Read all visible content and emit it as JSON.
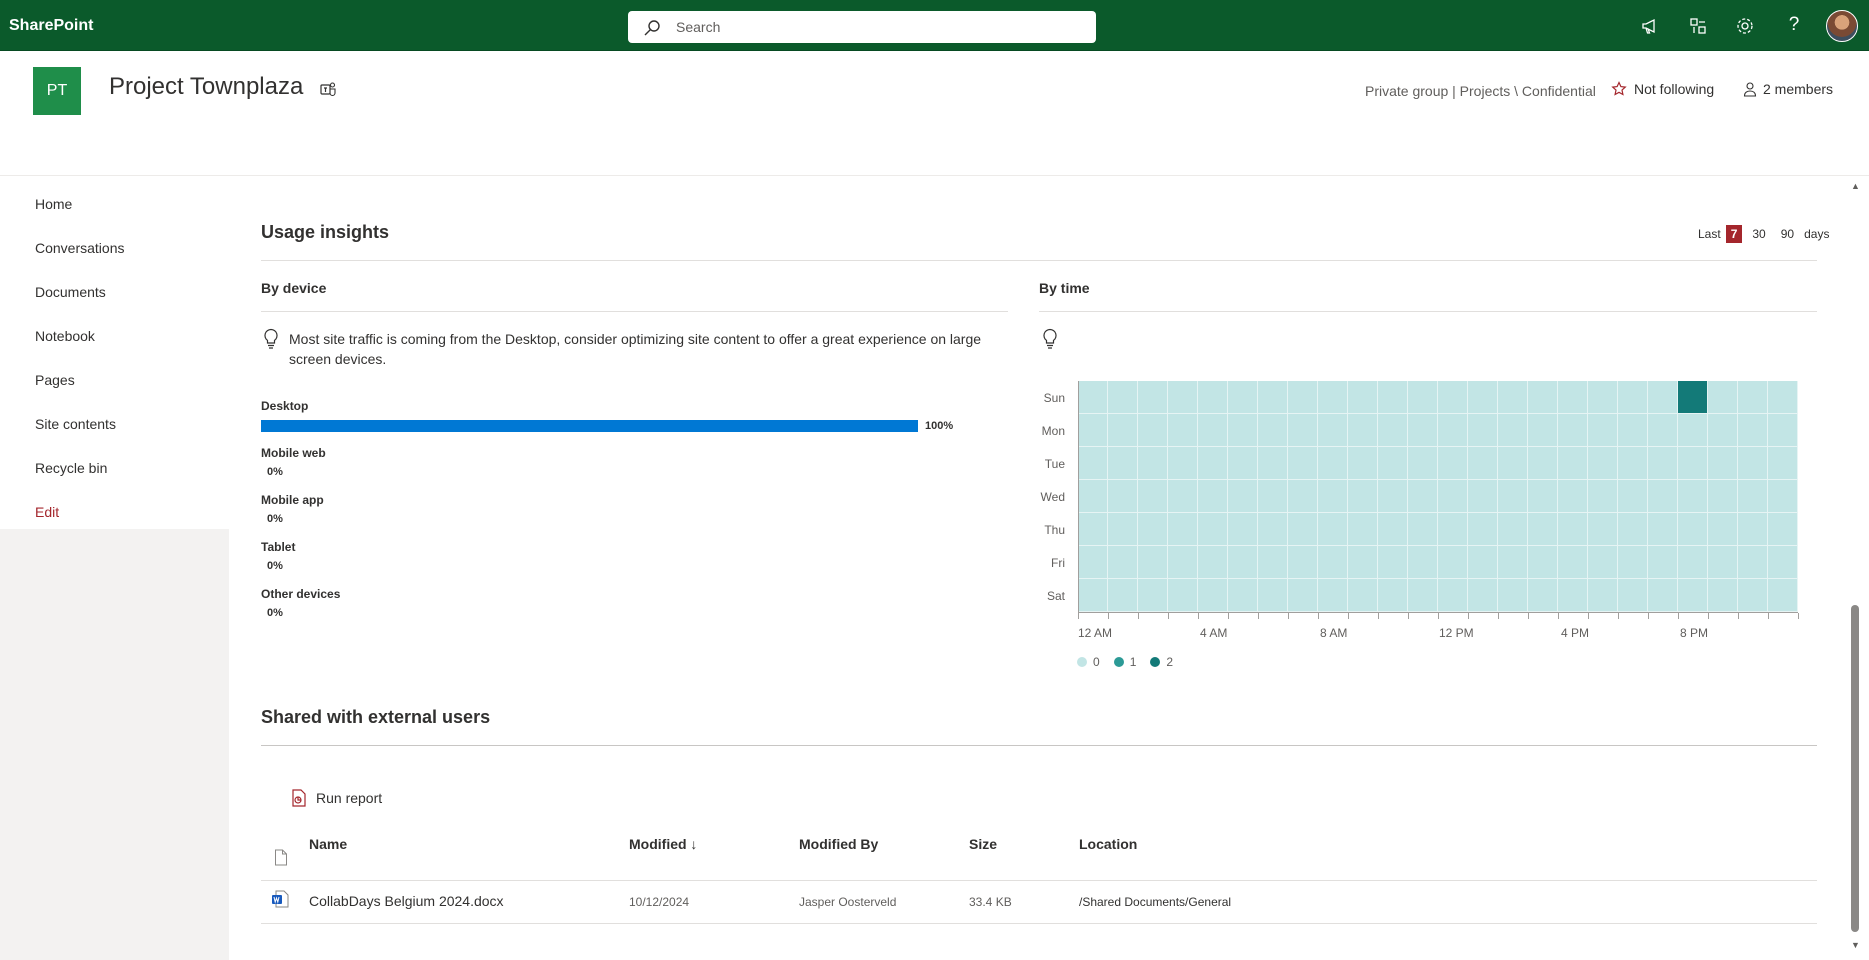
{
  "suite": {
    "brand": "SharePoint",
    "search_placeholder": "Search",
    "icons": [
      "megaphone-icon",
      "app-switch-icon",
      "gear-icon",
      "help-icon"
    ],
    "colors": {
      "bar": "#0b5a2b",
      "accent": "#a4262c",
      "brand_green": "#1f8e4a",
      "device_bar": "#0078d4"
    }
  },
  "site": {
    "logo_initials": "PT",
    "title": "Project Townplaza",
    "classification": "Private group | Projects \\ Confidential",
    "follow_label": "Not following",
    "members_label": "2 members"
  },
  "nav": {
    "items": [
      "Home",
      "Conversations",
      "Documents",
      "Notebook",
      "Pages",
      "Site contents",
      "Recycle bin"
    ],
    "edit_label": "Edit"
  },
  "usage": {
    "title": "Usage insights",
    "range": {
      "prefix": "Last",
      "options": [
        "7",
        "30",
        "90"
      ],
      "selected": "7",
      "suffix": "days"
    },
    "by_device": {
      "title": "By device",
      "tip": "Most site traffic is coming from the Desktop, consider optimizing site content to offer a great experience on large screen devices.",
      "devices": [
        {
          "label": "Desktop",
          "pct": "100%",
          "value": 1.0
        },
        {
          "label": "Mobile web",
          "pct": "0%",
          "value": 0
        },
        {
          "label": "Mobile app",
          "pct": "0%",
          "value": 0
        },
        {
          "label": "Tablet",
          "pct": "0%",
          "value": 0
        },
        {
          "label": "Other devices",
          "pct": "0%",
          "value": 0
        }
      ]
    },
    "by_time": {
      "title": "By time",
      "days": [
        "Sun",
        "Mon",
        "Tue",
        "Wed",
        "Thu",
        "Fri",
        "Sat"
      ],
      "hour_labels": [
        "12 AM",
        "4 AM",
        "8 AM",
        "12 PM",
        "4 PM",
        "8 PM"
      ],
      "legend": [
        {
          "label": "0",
          "color": "#c2e5e5"
        },
        {
          "label": "1",
          "color": "#2c9a96"
        },
        {
          "label": "2",
          "color": "#137a78"
        }
      ],
      "nonzero": [
        {
          "day": "Sun",
          "hour": 20,
          "value": 2
        }
      ]
    }
  },
  "shared": {
    "title": "Shared with external users",
    "run_report_label": "Run report",
    "columns": {
      "name": "Name",
      "modified": "Modified ↓",
      "modified_by": "Modified By",
      "size": "Size",
      "location": "Location"
    },
    "rows": [
      {
        "name": "CollabDays Belgium 2024.docx",
        "modified": "10/12/2024",
        "modified_by": "Jasper Oosterveld",
        "size": "33.4 KB",
        "location": "/Shared Documents/General"
      }
    ]
  }
}
